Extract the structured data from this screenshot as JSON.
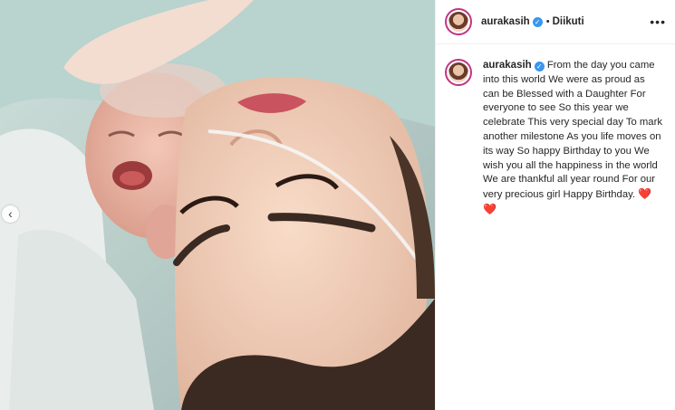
{
  "post": {
    "username": "aurakasih",
    "follow_state": "Diikuti",
    "separator": "•",
    "more_icon": "more-horizontal-icon",
    "verified_icon": "verified-badge-icon",
    "caption": "From the day you came into this world We were as proud as can be Blessed with a Daughter For everyone to see So this year we celebrate This very special day To mark another milestone As you life moves on its way So happy Birthday to you We wish you all the happiness in the world We are thankful all year round For our very precious girl Happy Birthday.",
    "caption_emoji": "❤️❤️"
  },
  "carousel": {
    "prev_icon": "chevron-left-icon",
    "prev_glyph": "‹"
  },
  "colors": {
    "story_ring": "#c13584",
    "verified": "#3897f0",
    "heart": "#ed4956"
  }
}
